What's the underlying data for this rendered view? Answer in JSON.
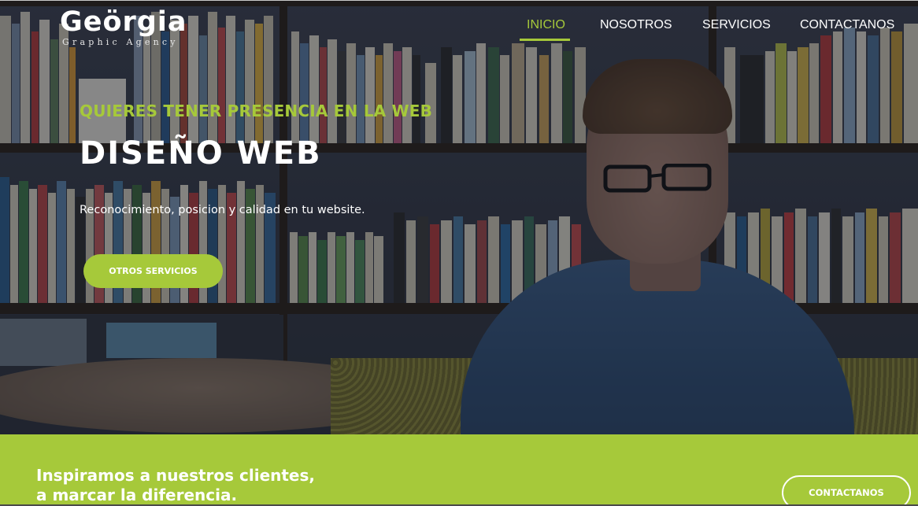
{
  "brand": {
    "name": "Geörgia",
    "tagline": "Graphic Agency"
  },
  "nav": {
    "items": [
      {
        "label": "INICIO",
        "active": true
      },
      {
        "label": "NOSOTROS",
        "active": false
      },
      {
        "label": "SERVICIOS",
        "active": false
      },
      {
        "label": "CONTACTANOS",
        "active": false
      }
    ]
  },
  "hero": {
    "kicker": "QUIERES TENER PRESENCIA EN LA WEB",
    "headline": "DISEÑO WEB",
    "subtext": "Reconocimiento, posicion y calidad en tu website.",
    "cta_label": "OTROS SERVICIOS"
  },
  "band": {
    "title_line1": "Inspiramos a nuestros clientes,",
    "title_line2": "a marcar la diferencia.",
    "cta_label": "CONTACTANOS"
  },
  "colors": {
    "accent": "#a6c93a",
    "text_light": "#ffffff"
  }
}
